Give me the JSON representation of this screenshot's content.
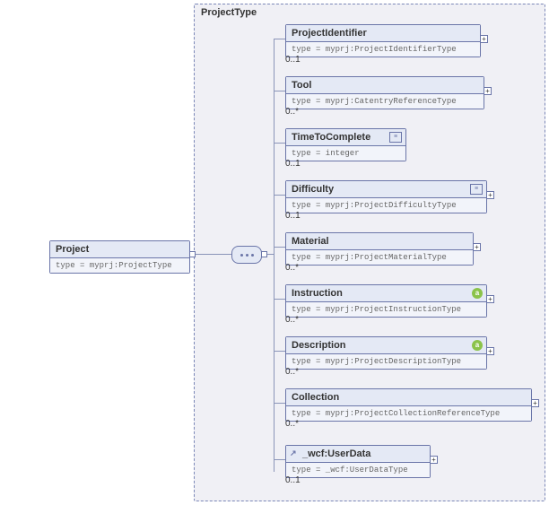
{
  "root": {
    "name": "Project",
    "type": "type = myprj:ProjectType"
  },
  "complexType": "ProjectType",
  "children": [
    {
      "name": "ProjectIdentifier",
      "type": "type = myprj:ProjectIdentifierType",
      "card": "0..1",
      "icon": "none",
      "expand": true
    },
    {
      "name": "Tool",
      "type": "type = myprj:CatentryReferenceType",
      "card": "0..*",
      "icon": "none",
      "expand": true
    },
    {
      "name": "TimeToComplete",
      "type": "type = integer",
      "card": "0..1",
      "icon": "doc",
      "expand": false
    },
    {
      "name": "Difficulty",
      "type": "type = myprj:ProjectDifficultyType",
      "card": "0..1",
      "icon": "doc",
      "expand": true
    },
    {
      "name": "Material",
      "type": "type = myprj:ProjectMaterialType",
      "card": "0..*",
      "icon": "none",
      "expand": true
    },
    {
      "name": "Instruction",
      "type": "type = myprj:ProjectInstructionType",
      "card": "0..*",
      "icon": "a",
      "expand": true
    },
    {
      "name": "Description",
      "type": "type = myprj:ProjectDescriptionType",
      "card": "0..*",
      "icon": "a",
      "expand": true
    },
    {
      "name": "Collection",
      "type": "type = myprj:ProjectCollectionReferenceType",
      "card": "0..*",
      "icon": "none",
      "expand": true
    },
    {
      "name": "_wcf:UserData",
      "type": "type = _wcf:UserDataType",
      "card": "0..1",
      "icon": "ref",
      "expand": true
    }
  ]
}
